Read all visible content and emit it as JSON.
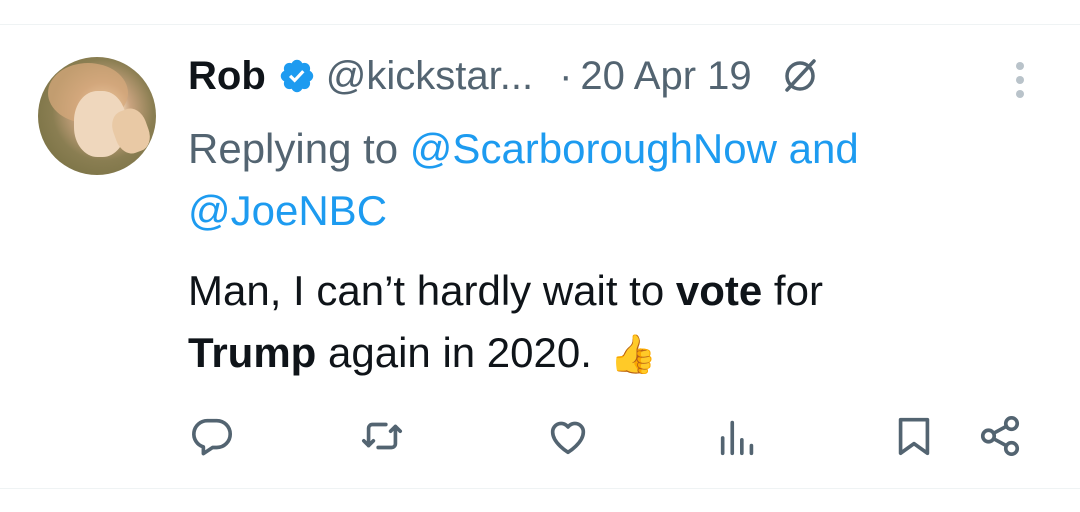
{
  "tweet": {
    "author_name": "Rob",
    "author_handle": "@kickstar...",
    "separator": "·",
    "date": "20 Apr 19",
    "replying_prefix": "Replying to ",
    "replying_to_1": "@ScarboroughNow",
    "replying_and": " and",
    "replying_to_2": "@JoeNBC",
    "text_part1": "Man, I can’t hardly wait to ",
    "text_bold1": "vote",
    "text_part2": " for ",
    "text_bold2": "Trump",
    "text_part3": " again in 2020. ",
    "emoji": "👍"
  },
  "icons": {
    "verified": "verified-badge-icon",
    "grok": "grok-icon",
    "more": "more-vertical-icon",
    "reply": "reply-icon",
    "retweet": "retweet-icon",
    "like": "heart-icon",
    "views": "views-icon",
    "bookmark": "bookmark-icon",
    "share": "share-icon"
  },
  "colors": {
    "text": "#0f1419",
    "secondary": "#536471",
    "link": "#1d9bf0",
    "verified": "#1d9bf0"
  }
}
